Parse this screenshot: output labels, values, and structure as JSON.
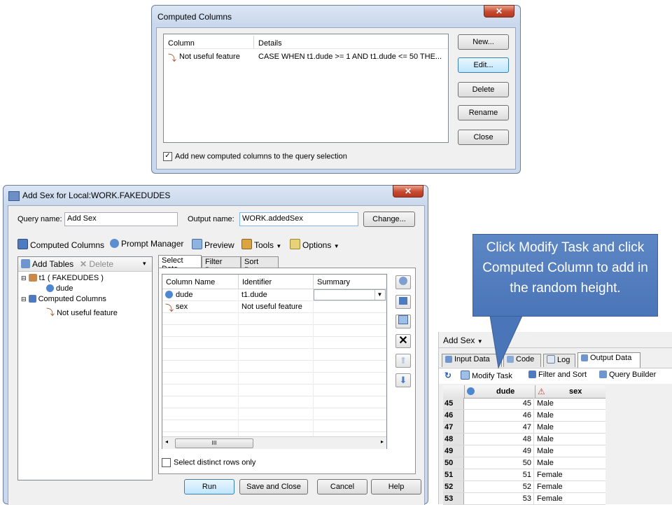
{
  "computed_dialog": {
    "title": "Computed Columns",
    "columns": [
      "Column",
      "Details"
    ],
    "rows": [
      {
        "column": "Not useful feature",
        "details": "CASE WHEN t1.dude >= 1 AND t1.dude <= 50 THE..."
      }
    ],
    "buttons": [
      "New...",
      "Edit...",
      "Delete",
      "Rename",
      "Close"
    ],
    "checkbox_label": "Add new computed columns to the query selection"
  },
  "query_dialog": {
    "title": "Add Sex for Local:WORK.FAKEDUDES",
    "query_name_label": "Query name:",
    "query_name_value": "Add Sex",
    "output_name_label": "Output name:",
    "output_name_value": "WORK.addedSex",
    "change_label": "Change...",
    "toolbar": [
      "Computed Columns",
      "Prompt Manager",
      "Preview",
      "Tools",
      "Options"
    ],
    "left_toolbar": {
      "add": "Add Tables",
      "delete": "Delete"
    },
    "tree": {
      "table": "t1 ( FAKEDUDES )",
      "col": "dude",
      "computed": "Computed Columns",
      "feature": "Not useful feature"
    },
    "tabs": [
      "Select Data",
      "Filter Data",
      "Sort Data"
    ],
    "grid_headers": [
      "Column Name",
      "Identifier",
      "Summary"
    ],
    "grid_rows": [
      {
        "name": "dude",
        "identifier": "t1.dude"
      },
      {
        "name": "sex",
        "identifier": "Not useful feature"
      }
    ],
    "scroll_mark": "III",
    "distinct_label": "Select distinct rows only",
    "bottom_buttons": [
      "Run",
      "Save and Close",
      "Cancel",
      "Help"
    ]
  },
  "callout_text": "Click Modify Task and click Computed Column to add in the random height.",
  "output_panel": {
    "title": "Add Sex",
    "tabs": [
      "Input Data",
      "Code",
      "Log",
      "Output Data"
    ],
    "toolbar": [
      "Modify Task",
      "Filter and Sort",
      "Query Builder"
    ],
    "columns": [
      "dude",
      "sex"
    ],
    "rows": [
      {
        "n": "45",
        "dude": "45",
        "sex": "Male"
      },
      {
        "n": "46",
        "dude": "46",
        "sex": "Male"
      },
      {
        "n": "47",
        "dude": "47",
        "sex": "Male"
      },
      {
        "n": "48",
        "dude": "48",
        "sex": "Male"
      },
      {
        "n": "49",
        "dude": "49",
        "sex": "Male"
      },
      {
        "n": "50",
        "dude": "50",
        "sex": "Male"
      },
      {
        "n": "51",
        "dude": "51",
        "sex": "Female"
      },
      {
        "n": "52",
        "dude": "52",
        "sex": "Female"
      },
      {
        "n": "53",
        "dude": "53",
        "sex": "Female"
      }
    ]
  }
}
